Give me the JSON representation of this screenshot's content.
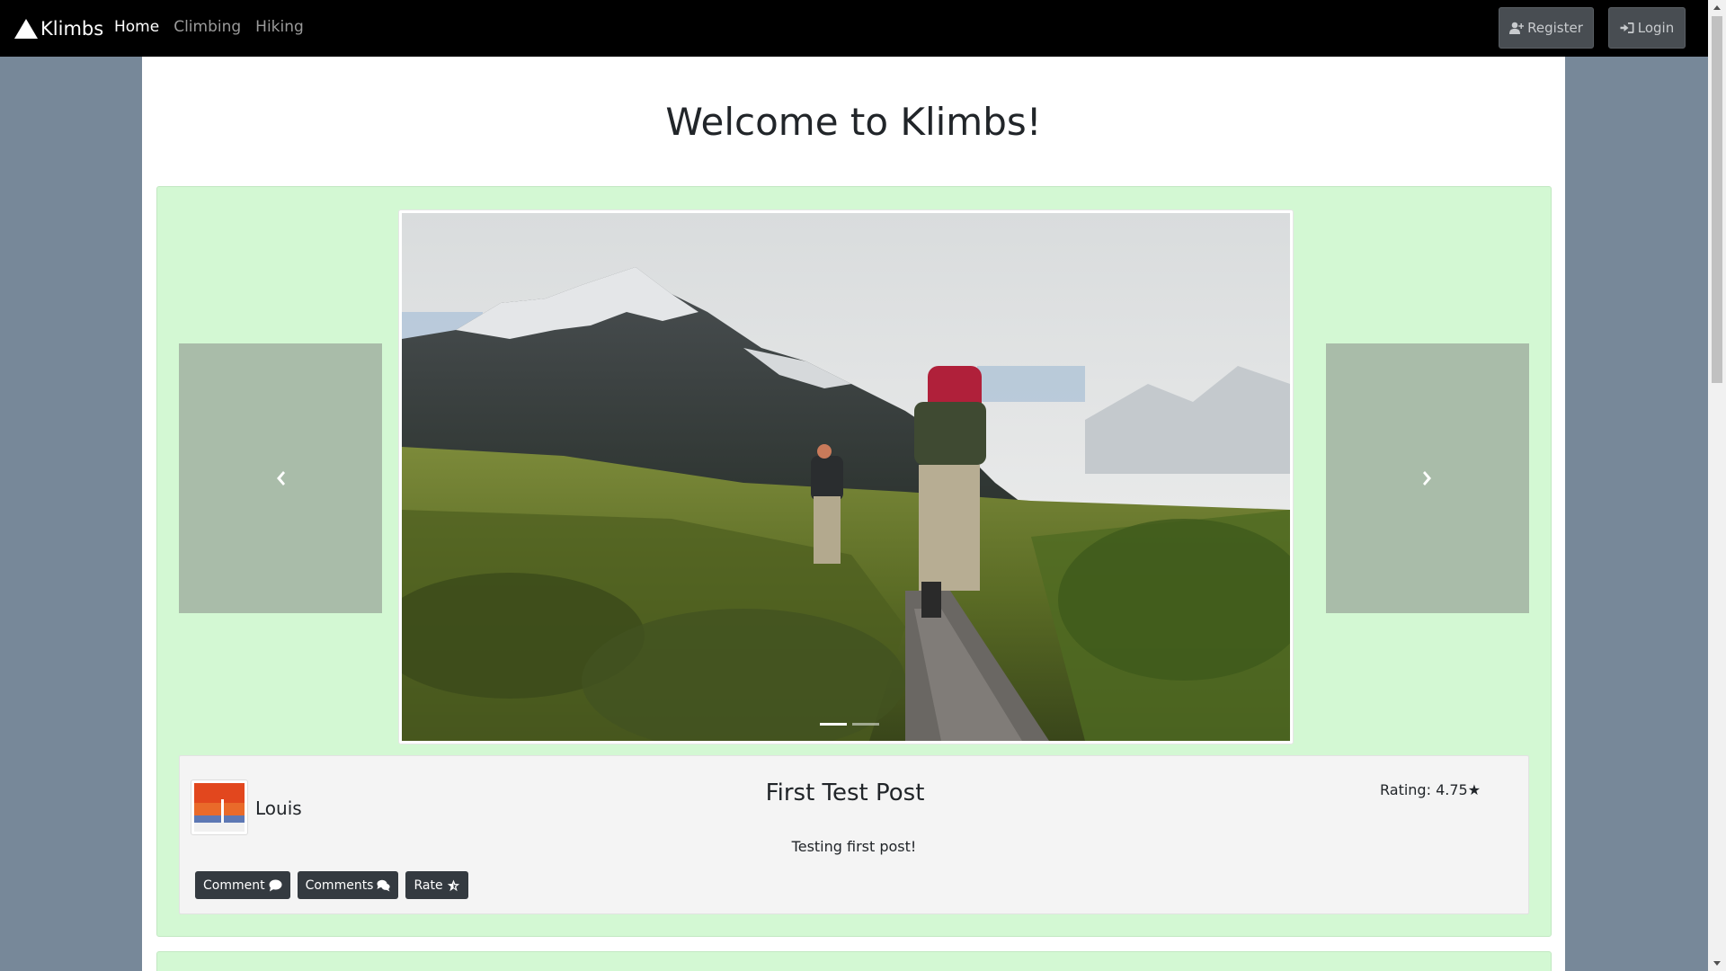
{
  "navbar": {
    "brand": "Klimbs",
    "links": [
      "Home",
      "Climbing",
      "Hiking"
    ],
    "active_link": "Home",
    "register_label": "Register",
    "login_label": "Login"
  },
  "main": {
    "title": "Welcome to Klimbs!"
  },
  "post": {
    "author": "Louis",
    "title": "First Test Post",
    "rating_label": "Rating: 4.75★",
    "text": "Testing first post!",
    "buttons": {
      "comment": "Comment",
      "comments": "Comments",
      "rate": "Rate"
    },
    "carousel": {
      "slide_count": 2,
      "active_slide": 1
    }
  },
  "colors": {
    "navbar_bg": "#000000",
    "page_bg": "#778899",
    "card_bg": "#d3f8d3",
    "control_bg": "#a9bca9",
    "button_dark": "#343a40"
  }
}
